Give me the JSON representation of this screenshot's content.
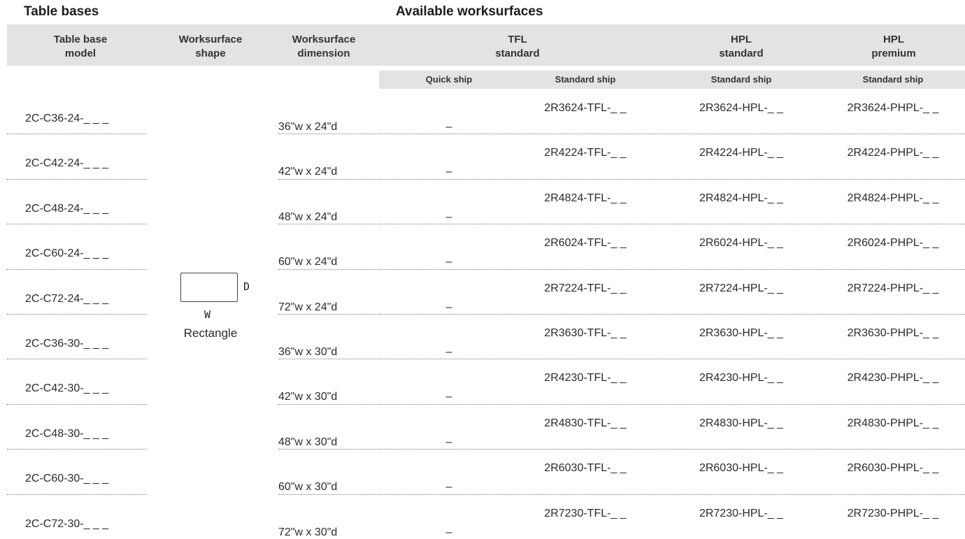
{
  "titles": {
    "left": "Table bases",
    "right": "Available worksurfaces"
  },
  "headers": {
    "model": [
      "Table base",
      "model"
    ],
    "shape": [
      "Worksurface",
      "shape"
    ],
    "dimension": [
      "Worksurface",
      "dimension"
    ],
    "tfl": [
      "TFL",
      "standard"
    ],
    "hpl": [
      "HPL",
      "standard"
    ],
    "phpl": [
      "HPL",
      "premium"
    ]
  },
  "subheaders": {
    "quick": "Quick ship",
    "tfl": "Standard ship",
    "hpl": "Standard ship",
    "phpl": "Standard ship"
  },
  "shape": {
    "d_label": "D",
    "w_label": "W",
    "name": "Rectangle"
  },
  "rows": [
    {
      "model": "2C-C36-24-_ _ _",
      "dim": "36\"w x 24\"d",
      "quick": "–",
      "tfl": "2R3624-TFL-_ _",
      "hpl": "2R3624-HPL-_ _",
      "phpl": "2R3624-PHPL-_ _"
    },
    {
      "model": "2C-C42-24-_ _ _",
      "dim": "42\"w x 24\"d",
      "quick": "–",
      "tfl": "2R4224-TFL-_ _",
      "hpl": "2R4224-HPL-_ _",
      "phpl": "2R4224-PHPL-_ _"
    },
    {
      "model": "2C-C48-24-_ _ _",
      "dim": "48\"w x 24\"d",
      "quick": "–",
      "tfl": "2R4824-TFL-_ _",
      "hpl": "2R4824-HPL-_ _",
      "phpl": "2R4824-PHPL-_ _"
    },
    {
      "model": "2C-C60-24-_ _ _",
      "dim": "60\"w x 24\"d",
      "quick": "–",
      "tfl": "2R6024-TFL-_ _",
      "hpl": "2R6024-HPL-_ _",
      "phpl": "2R6024-PHPL-_ _"
    },
    {
      "model": "2C-C72-24-_ _ _",
      "dim": "72\"w x 24\"d",
      "quick": "–",
      "tfl": "2R7224-TFL-_ _",
      "hpl": "2R7224-HPL-_ _",
      "phpl": "2R7224-PHPL-_ _"
    },
    {
      "model": "2C-C36-30-_ _ _",
      "dim": "36\"w x 30\"d",
      "quick": "–",
      "tfl": "2R3630-TFL-_ _",
      "hpl": "2R3630-HPL-_ _",
      "phpl": "2R3630-PHPL-_ _"
    },
    {
      "model": "2C-C42-30-_ _ _",
      "dim": "42\"w x 30\"d",
      "quick": "–",
      "tfl": "2R4230-TFL-_ _",
      "hpl": "2R4230-HPL-_ _",
      "phpl": "2R4230-PHPL-_ _"
    },
    {
      "model": "2C-C48-30-_ _ _",
      "dim": "48\"w x 30\"d",
      "quick": "–",
      "tfl": "2R4830-TFL-_ _",
      "hpl": "2R4830-HPL-_ _",
      "phpl": "2R4830-PHPL-_ _"
    },
    {
      "model": "2C-C60-30-_ _ _",
      "dim": "60\"w x 30\"d",
      "quick": "–",
      "tfl": "2R6030-TFL-_ _",
      "hpl": "2R6030-HPL-_ _",
      "phpl": "2R6030-PHPL-_ _"
    },
    {
      "model": "2C-C72-30-_ _ _",
      "dim": "72\"w x 30\"d",
      "quick": "–",
      "tfl": "2R7230-TFL-_ _",
      "hpl": "2R7230-HPL-_ _",
      "phpl": "2R7230-PHPL-_ _"
    }
  ]
}
